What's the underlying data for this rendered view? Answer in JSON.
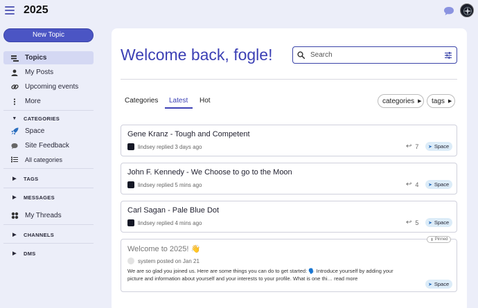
{
  "header": {
    "site_title": "2025",
    "icons": {
      "menu": "hamburger-icon",
      "chat": "chat-bubble-icon",
      "avatar": "user-avatar"
    }
  },
  "sidebar": {
    "new_topic_label": "New Topic",
    "primary": [
      {
        "label": "Topics",
        "icon": "topics-icon",
        "active": true
      },
      {
        "label": "My Posts",
        "icon": "person-icon"
      },
      {
        "label": "Upcoming events",
        "icon": "link-icon"
      },
      {
        "label": "More",
        "icon": "vertical-dots-icon"
      }
    ],
    "sections": {
      "categories": "CATEGORIES",
      "tags": "TAGS",
      "messages": "MESSAGES",
      "channels": "CHANNELS",
      "dms": "DMS"
    },
    "categories": [
      {
        "label": "Space",
        "icon": "rocket-icon"
      },
      {
        "label": "Site Feedback",
        "icon": "speech-bubble-icon"
      },
      {
        "label": "All categories",
        "icon": "list-icon"
      }
    ],
    "messages": [
      {
        "label": "My Threads",
        "icon": "threads-icon"
      }
    ]
  },
  "main": {
    "welcome": "Welcome back, fogle!",
    "search_placeholder": "Search",
    "tabs": [
      {
        "label": "Categories"
      },
      {
        "label": "Latest",
        "active": true
      },
      {
        "label": "Hot"
      }
    ],
    "filters": {
      "categories": "categories",
      "tags": "tags"
    },
    "topics": [
      {
        "title": "Gene Kranz - Tough and Competent",
        "meta": "lindsey replied 3 days ago",
        "replies": "7",
        "category": "Space"
      },
      {
        "title": "John F. Kennedy - We Choose to go to the Moon",
        "meta": "lindsey replied 5 mins ago",
        "replies": "4",
        "category": "Space"
      },
      {
        "title": "Carl Sagan - Pale Blue Dot",
        "meta": "lindsey replied 4 mins ago",
        "replies": "5",
        "category": "Space"
      }
    ],
    "pinned": {
      "tag": "Pinned",
      "title": "Welcome to 2025! 👋",
      "meta": "system posted on Jan 21",
      "excerpt": "We are so glad you joined us. Here are some things you can do to get started: 🗣️ Introduce yourself by adding your picture and information about yourself and your interests to your profile. What is one thi… read more",
      "category": "Space"
    }
  },
  "colors": {
    "accent": "#3c40b5",
    "button": "#4b55c4",
    "page_bg": "#eceef9",
    "badge_bg": "#dcecf8"
  }
}
